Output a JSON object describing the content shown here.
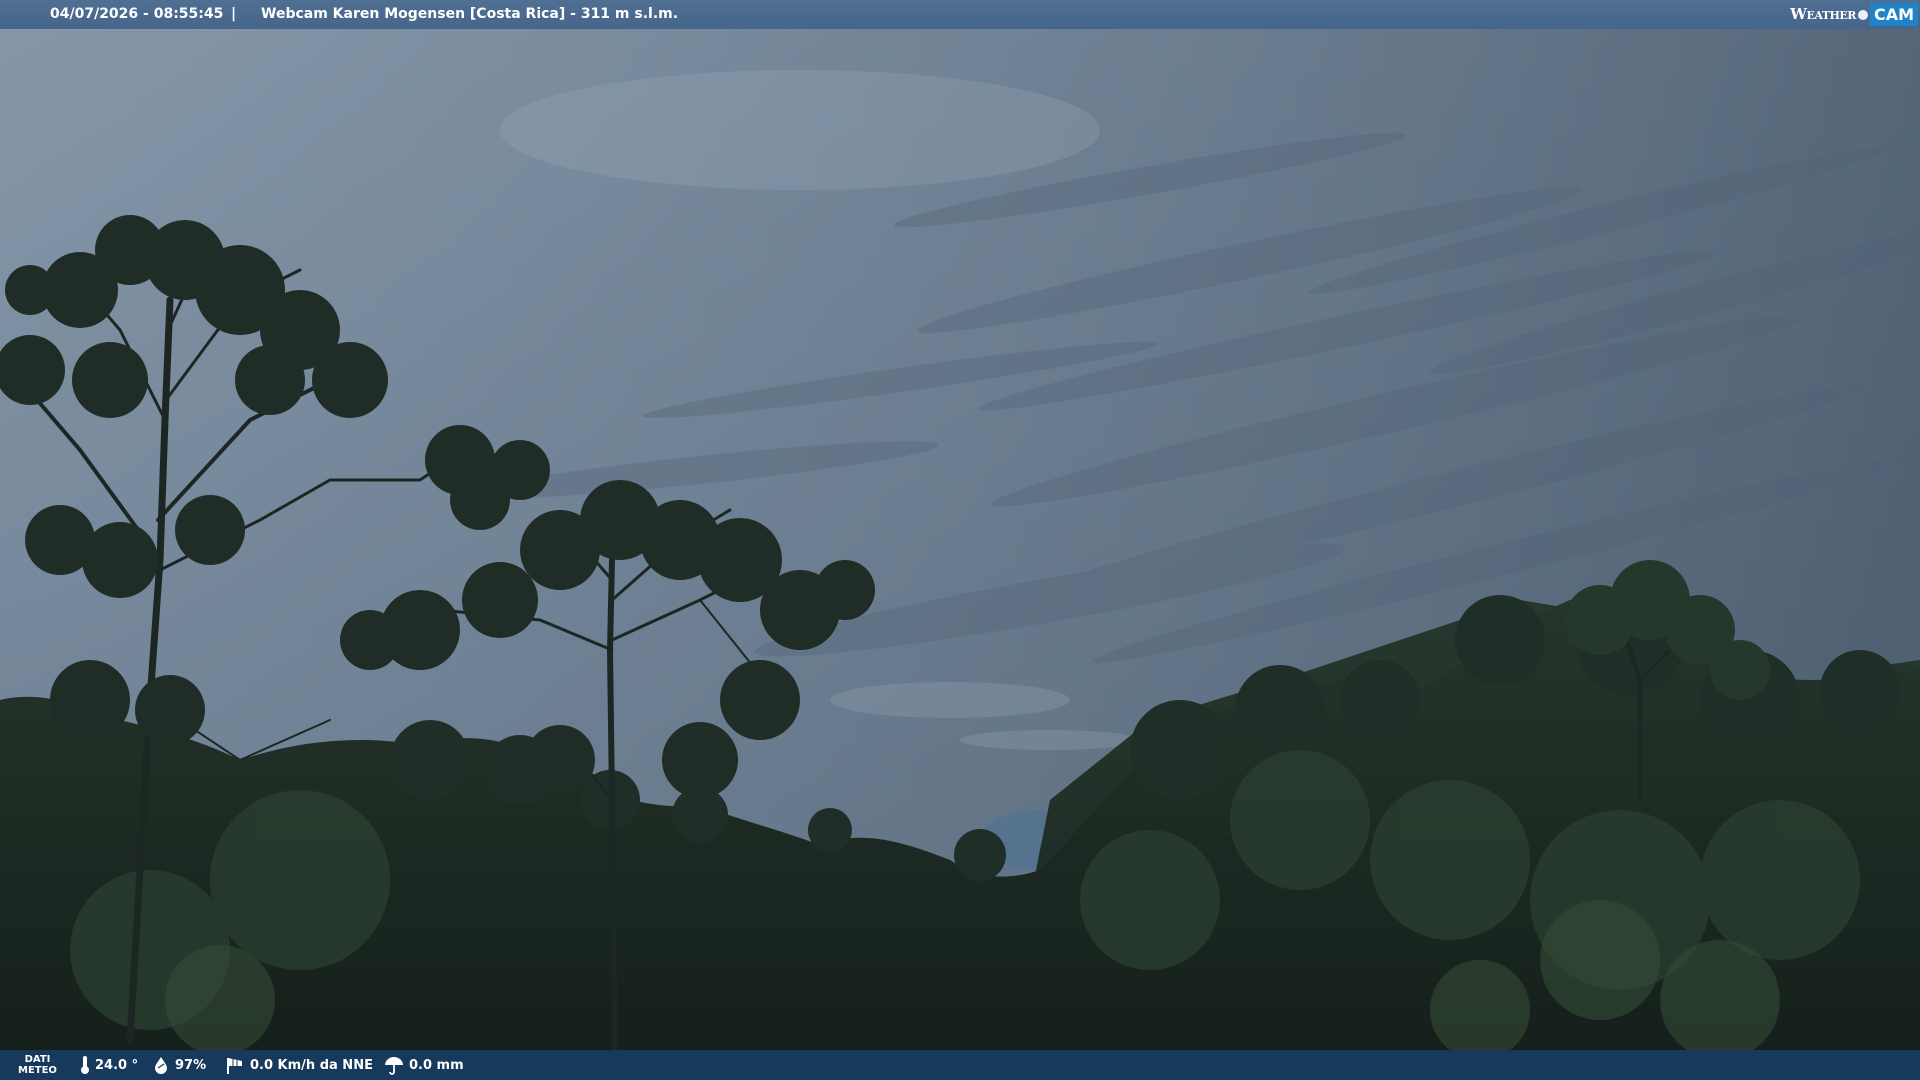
{
  "header": {
    "datetime": "04/07/2026 - 08:55:45",
    "separator": "|",
    "title": "Webcam Karen Mogensen [Costa Rica]  - 311 m s.l.m."
  },
  "logo": {
    "weather": "Weather",
    "cam": "CAM"
  },
  "footer": {
    "dati_line1": "DATI",
    "dati_line2": "METEO",
    "temperature": "24.0 °",
    "humidity": "97%",
    "wind": "0.0 Km/h da NNE",
    "rain": "0.0 mm"
  },
  "icons": {
    "temperature": "thermometer-icon",
    "humidity": "drop-icon",
    "wind": "windsock-icon",
    "rain": "umbrella-icon"
  },
  "colors": {
    "top_bar": "#4a6a8f",
    "bottom_bar": "#173a5c",
    "sky": "#7f93a6",
    "foliage": "#1d2b22"
  }
}
